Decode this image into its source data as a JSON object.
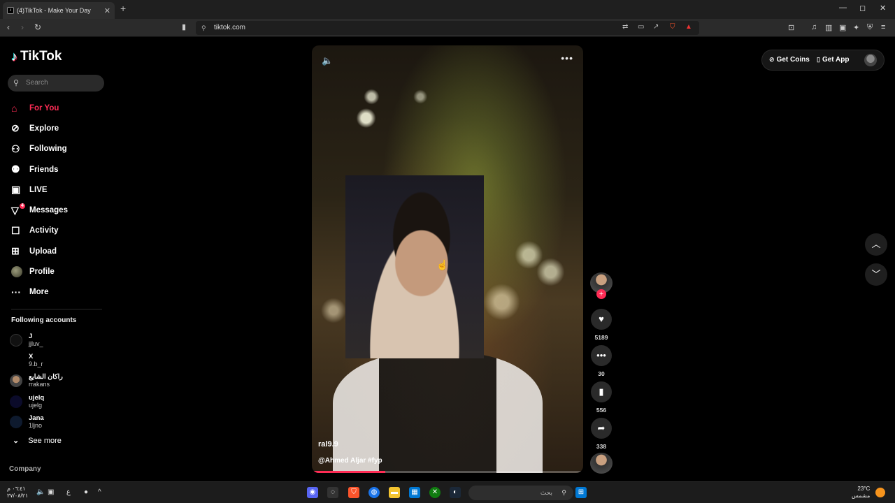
{
  "browser": {
    "tab_title": "(4)TikTok - Make Your Day",
    "tab_favicon": "tiktok-logo",
    "new_tab_icon": "+",
    "url": "tiktok.com",
    "controls": {
      "minimize": "—",
      "maximize": "◻",
      "close": "✕"
    }
  },
  "sidebar": {
    "logo": "TikTok",
    "search_placeholder": "Search",
    "nav": [
      {
        "label": "For You",
        "icon": "home-icon",
        "active": true
      },
      {
        "label": "Explore",
        "icon": "compass-icon"
      },
      {
        "label": "Following",
        "icon": "user-follow-icon"
      },
      {
        "label": "Friends",
        "icon": "friends-icon"
      },
      {
        "label": "LIVE",
        "icon": "live-icon"
      },
      {
        "label": "Messages",
        "icon": "messages-icon",
        "badge": "4"
      },
      {
        "label": "Activity",
        "icon": "activity-icon"
      },
      {
        "label": "Upload",
        "icon": "upload-icon"
      },
      {
        "label": "Profile",
        "icon": "profile-avatar"
      },
      {
        "label": "More",
        "icon": "more-dots-icon"
      }
    ],
    "following_header": "Following accounts",
    "following": [
      {
        "name": "J",
        "user": "jjluv_"
      },
      {
        "name": "X",
        "user": "9.b_r"
      },
      {
        "name": "راكان الشايع",
        "user": "rrakans"
      },
      {
        "name": "ujelq",
        "user": "ujelg"
      },
      {
        "name": "Jana",
        "user": "1ljno"
      }
    ],
    "see_more": "See more",
    "company": "Company"
  },
  "video": {
    "username": "ral9.9",
    "caption": "@Ahmed Aljar #fyp",
    "progress": 0.27
  },
  "actions": {
    "likes": "5189",
    "comments": "30",
    "saves": "556",
    "shares": "338"
  },
  "top_right": {
    "get_coins": "Get Coins",
    "get_app": "Get App"
  },
  "taskbar": {
    "time": "٠٦:٤١ م",
    "date": "٢٧/٠٨/٢١",
    "search_placeholder": "بحث",
    "weather_temp": "23°C",
    "weather_desc": "مشمس",
    "lang": "ع"
  }
}
